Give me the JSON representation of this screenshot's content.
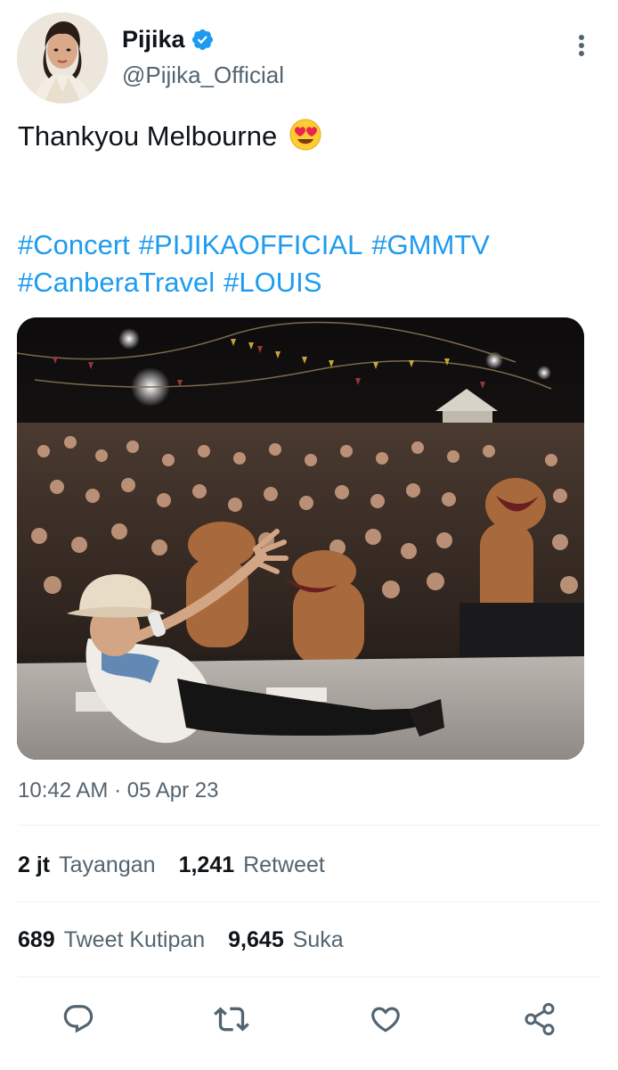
{
  "header": {
    "display_name": "Pijika",
    "handle": "@Pijika_Official",
    "verified": true,
    "avatar_icon": "profile-photo",
    "more_icon": "more-vertical-icon"
  },
  "tweet": {
    "text": "Thankyou Melbourne",
    "emoji": "heart-eyes-emoji",
    "hashtags": [
      "#Concert",
      "#PIJIKAOFFICIAL",
      "#GMMTV",
      "#CanberaTravel",
      "#LOUIS"
    ]
  },
  "media": {
    "kind": "photo",
    "subject": "concert-selfie-photo"
  },
  "meta": {
    "timestamp": "10:42 AM · 05 Apr 23"
  },
  "stats": {
    "views_value": "2 jt",
    "views_label": "Tayangan",
    "retweets_value": "1,241",
    "retweets_label": "Retweet",
    "quotes_value": "689",
    "quotes_label": "Tweet Kutipan",
    "likes_value": "9,645",
    "likes_label": "Suka"
  },
  "actions": {
    "icons": [
      "reply-icon",
      "retweet-icon",
      "like-icon",
      "share-icon"
    ]
  },
  "colors": {
    "link": "#1d9bf0",
    "secondary_text": "#536471",
    "primary_text": "#0f1419",
    "divider": "#eff3f4"
  }
}
